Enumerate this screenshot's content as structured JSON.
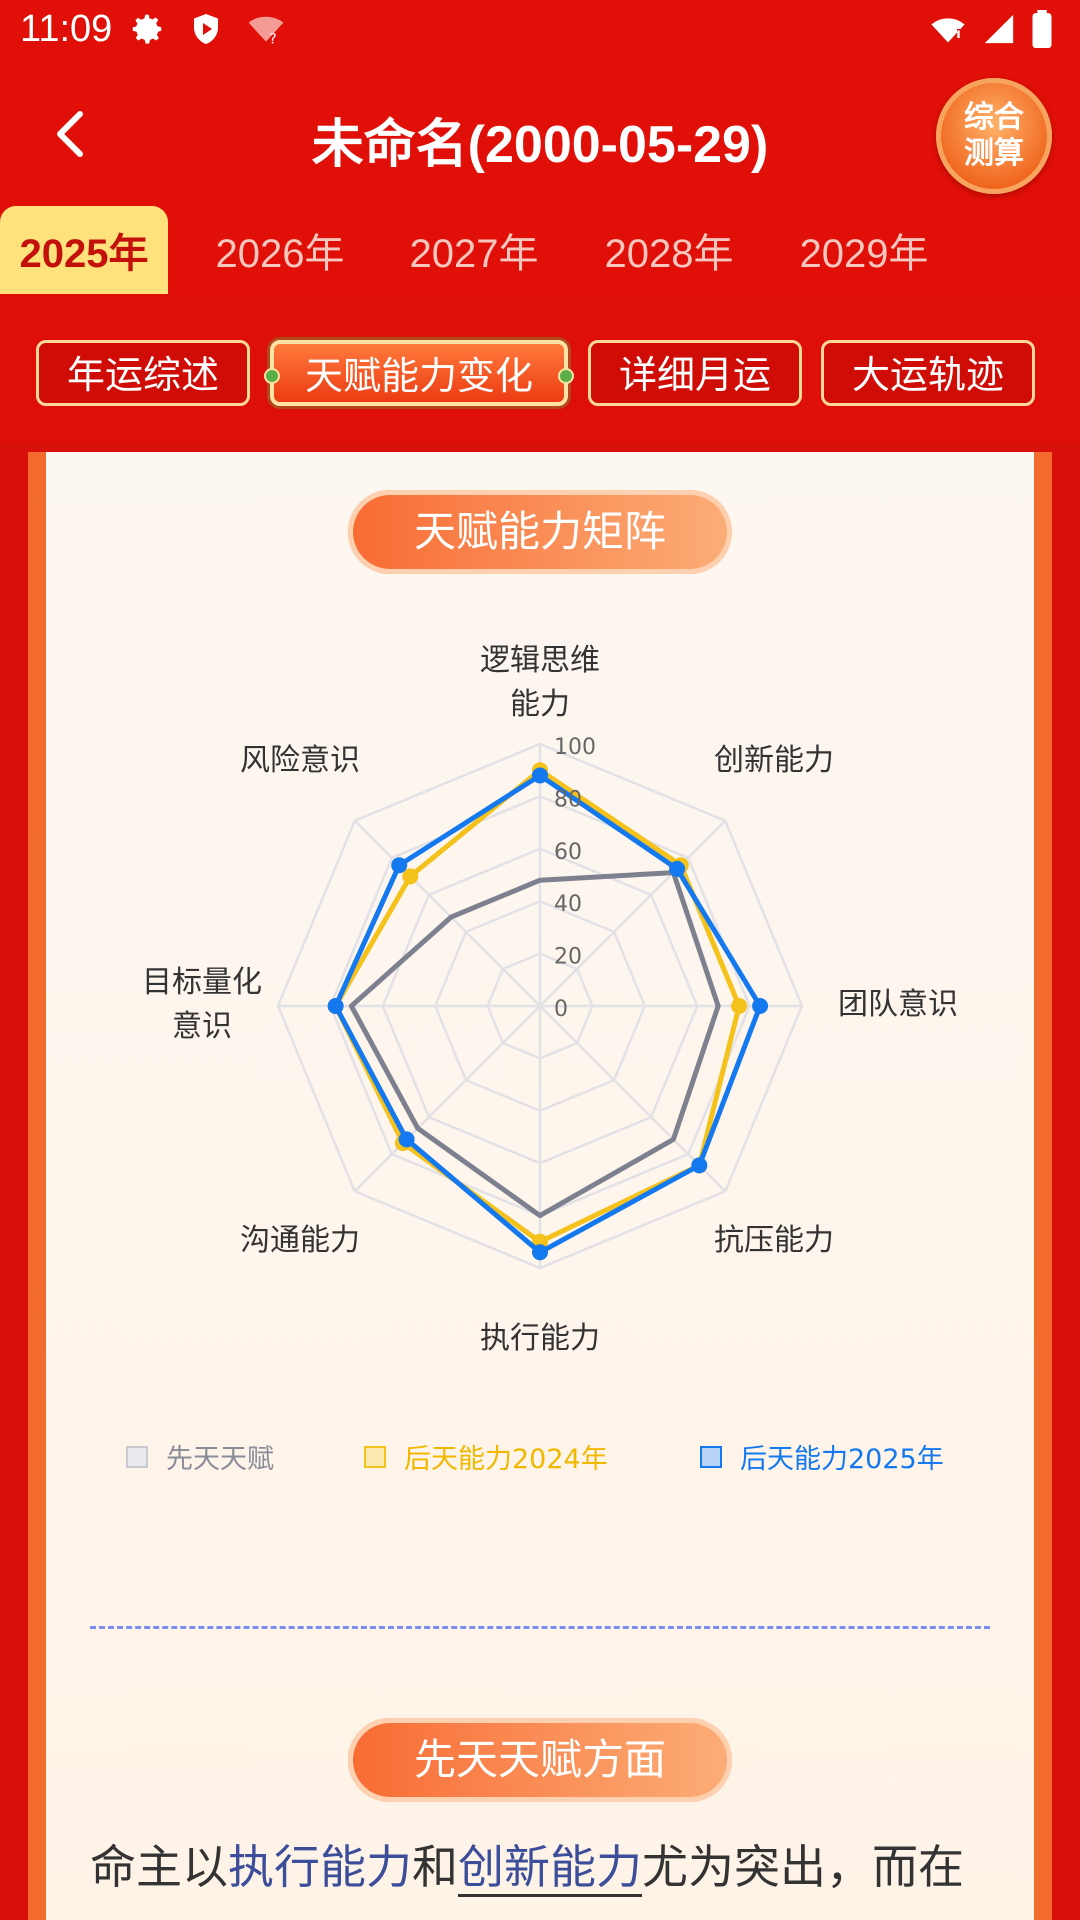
{
  "status": {
    "time": "11:09"
  },
  "header": {
    "title": "未命名(2000-05-29)",
    "badge_line1": "综合",
    "badge_line2": "测算"
  },
  "year_tabs": [
    "2025年",
    "2026年",
    "2027年",
    "2028年",
    "2029年"
  ],
  "active_year_index": 0,
  "sub_tabs": [
    "年运综述",
    "天赋能力变化",
    "详细月运",
    "大运轨迹"
  ],
  "active_sub_tab_index": 1,
  "section1_title": "天赋能力矩阵",
  "chart_data": {
    "type": "radar",
    "indicators": [
      {
        "name": "逻辑思维能力",
        "lines": [
          "逻辑思维",
          "能力"
        ]
      },
      {
        "name": "创新能力",
        "lines": [
          "创新能力"
        ]
      },
      {
        "name": "团队意识",
        "lines": [
          "团队意识"
        ]
      },
      {
        "name": "抗压能力",
        "lines": [
          "抗压能力"
        ]
      },
      {
        "name": "执行能力",
        "lines": [
          "执行能力"
        ]
      },
      {
        "name": "沟通能力",
        "lines": [
          "沟通能力"
        ]
      },
      {
        "name": "目标量化意识",
        "lines": [
          "目标量化",
          "意识"
        ]
      },
      {
        "name": "风险意识",
        "lines": [
          "风险意识"
        ]
      }
    ],
    "ticks": [
      "0",
      "20",
      "40",
      "60",
      "80",
      "100"
    ],
    "max": 100,
    "series": [
      {
        "name": "先天天赋",
        "values": [
          48,
          72,
          68,
          72,
          80,
          66,
          72,
          48
        ],
        "color": "#7d808f"
      },
      {
        "name": "后天能力2024年",
        "values": [
          90,
          76,
          76,
          86,
          90,
          74,
          78,
          70
        ],
        "color": "#f5c11b"
      },
      {
        "name": "后天能力2025年",
        "values": [
          88,
          74,
          84,
          86,
          94,
          72,
          78,
          76
        ],
        "color": "#1478ef"
      }
    ]
  },
  "section2_title": "先天天赋方面",
  "description": {
    "p1": "命主以",
    "h1": "执行能力",
    "p2": "和",
    "h2": "创新能力",
    "p3": "尤为突出，而在"
  }
}
